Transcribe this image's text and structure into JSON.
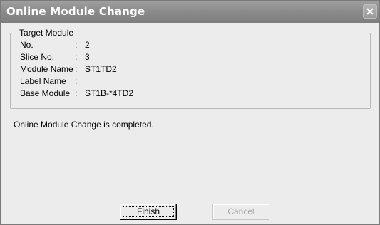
{
  "window": {
    "title": "Online Module Change"
  },
  "target_module": {
    "legend": "Target Module",
    "separator": ":",
    "rows": [
      {
        "label": "No.",
        "value": "2"
      },
      {
        "label": "Slice No.",
        "value": "3"
      },
      {
        "label": "Module Name",
        "value": "ST1TD2"
      },
      {
        "label": "Label Name",
        "value": ""
      },
      {
        "label": "Base Module",
        "value": "ST1B-*4TD2"
      }
    ]
  },
  "message": "Online Module Change is completed.",
  "buttons": {
    "finish_label": "Finish",
    "cancel_label": "Cancel"
  },
  "icons": {
    "close": "close-icon"
  },
  "colors": {
    "titlebar": "#8c8c8c",
    "dialog_bg": "#ececec",
    "disabled_text": "#a9a9a9"
  }
}
